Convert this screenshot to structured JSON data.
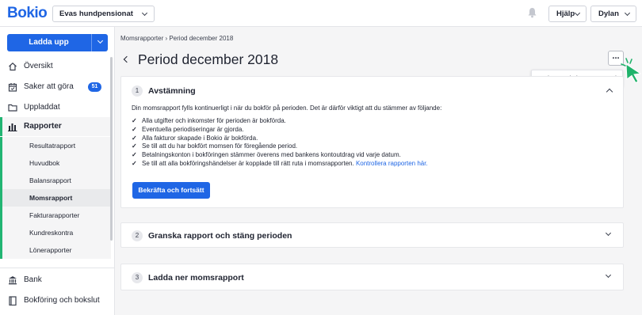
{
  "header": {
    "logo": "Bokio",
    "company": "Evas hundpensionat",
    "help_label": "Hjälp",
    "user_label": "Dylan"
  },
  "sidebar": {
    "upload_label": "Ladda upp",
    "items": [
      {
        "label": "Översikt",
        "icon": "home-icon"
      },
      {
        "label": "Saker att göra",
        "icon": "calendar-icon",
        "badge": "51"
      },
      {
        "label": "Uppladdat",
        "icon": "folder-icon"
      },
      {
        "label": "Rapporter",
        "icon": "bar-chart-icon"
      }
    ],
    "reports_sub": [
      "Resultatrapport",
      "Huvudbok",
      "Balansrapport",
      "Momsrapport",
      "Fakturarapporter",
      "Kundreskontra",
      "Lönerapporter"
    ],
    "bottom_items": [
      {
        "label": "Bank",
        "icon": "bank-icon"
      },
      {
        "label": "Bokföring och bokslut",
        "icon": "book-icon"
      }
    ]
  },
  "main": {
    "breadcrumb": "Momsrapporter › Period december 2018",
    "title": "Period december 2018",
    "more_label": "...",
    "tooltip": "Markera perioden som stängd",
    "sections": [
      {
        "number": "1",
        "title": "Avstämning",
        "intro": "Din momsrapport fylls kontinuerligt i när du bokför på perioden. Det är därför viktigt att du stämmer av följande:",
        "checks": [
          "Alla utgifter och inkomster för perioden är bokförda.",
          "Eventuella periodiseringar är gjorda.",
          "Alla fakturor skapade i Bokio är bokförda.",
          "Se till att du har bokfört momsen för föregående period.",
          "Betalningskonton i bokföringen stämmer överens med bankens kontoutdrag vid varje datum.",
          "Se till att alla bokföringshändelser är kopplade till rätt ruta i momsrapporten."
        ],
        "link_label": "Kontrollera rapporten här.",
        "button_label": "Bekräfta och fortsätt"
      },
      {
        "number": "2",
        "title": "Granska rapport och stäng perioden"
      },
      {
        "number": "3",
        "title": "Ladda ner momsrapport"
      }
    ]
  },
  "colors": {
    "brand_blue": "#1f66e5",
    "active_green": "#22b573",
    "cursor_green": "#1fb26a"
  }
}
